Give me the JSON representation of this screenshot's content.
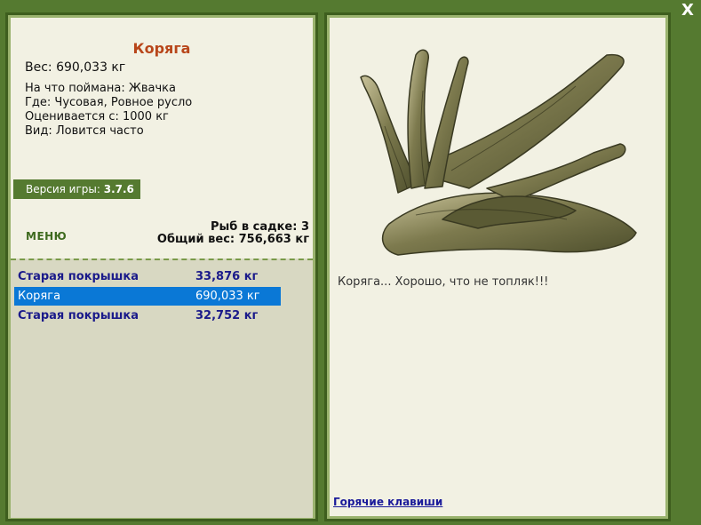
{
  "close": {
    "label": "X"
  },
  "fish": {
    "title": "Коряга",
    "weight_line": "Вес: 690,033 кг",
    "info": [
      "На что поймана: Жвачка",
      "Где: Чусовая, Ровное русло",
      "Оценивается с: 1000 кг",
      "Вид: Ловится часто"
    ],
    "description": "Коряга... Хорошо, что не топляк!!!"
  },
  "version": {
    "label": "Версия игры:",
    "value": "3.7.6"
  },
  "menu": {
    "label": "МЕНЮ"
  },
  "keep": {
    "count_line": "Рыб в садке: 3",
    "total_line": "Общий вес: 756,663 кг"
  },
  "catch_list": [
    {
      "name": "Старая покрышка",
      "weight": "33,876 кг",
      "selected": false
    },
    {
      "name": "Коряга",
      "weight": "690,033 кг",
      "selected": true
    },
    {
      "name": "Старая покрышка",
      "weight": "32,752 кг",
      "selected": false
    }
  ],
  "hotkeys": {
    "label": "Горячие клавиши"
  },
  "colors": {
    "background": "#557a30",
    "panel": "#f2f1e3",
    "selected": "#0a78d6",
    "title": "#b8461a"
  }
}
